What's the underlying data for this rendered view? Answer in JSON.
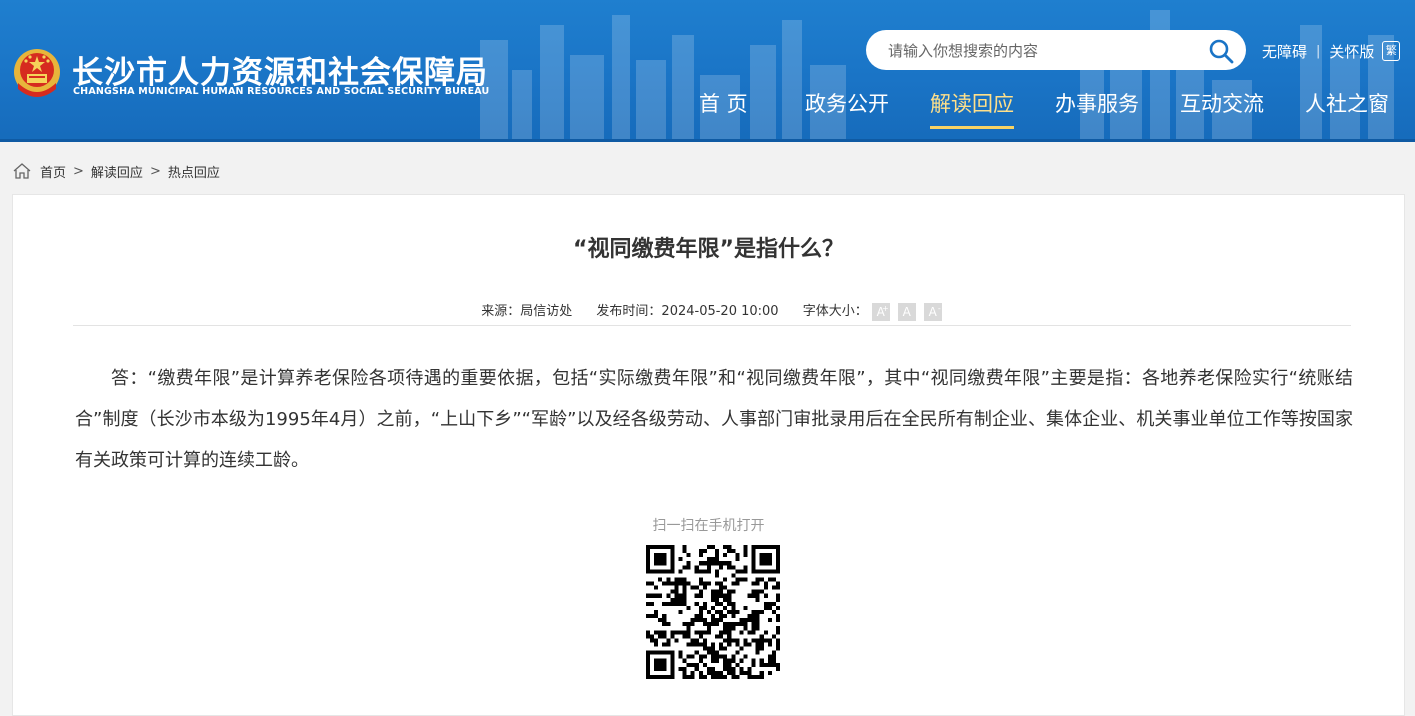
{
  "header": {
    "title": "长沙市人力资源和社会保障局",
    "subtitle": "CHANGSHA MUNICIPAL HUMAN RESOURCES AND SOCIAL SECURITY BUREAU",
    "search_placeholder": "请输入你想搜索的内容",
    "accessibility_link": "无障碍",
    "care_link": "关怀版",
    "traditional_label": "繁",
    "brand_color": "#1a74c6",
    "active_nav_color": "#ffe08a"
  },
  "nav": {
    "items": [
      {
        "label": "首 页"
      },
      {
        "label": "政务公开"
      },
      {
        "label": "解读回应"
      },
      {
        "label": "办事服务"
      },
      {
        "label": "互动交流"
      },
      {
        "label": "人社之窗"
      }
    ],
    "active_index": 2
  },
  "breadcrumb": {
    "items": [
      "首页",
      "解读回应",
      "热点回应"
    ],
    "separator": ">"
  },
  "article": {
    "title": "“视同缴费年限”是指什么？",
    "source": "来源：局信访处",
    "publish_time": "发布时间：2024-05-20 10:00",
    "font_size_label": "字体大小：",
    "font_buttons": {
      "large": "A",
      "large_sup": "+",
      "medium": "A",
      "small": "A",
      "small_sup": "-"
    },
    "body": "答：“缴费年限”是计算养老保险各项待遇的重要依据，包括“实际缴费年限”和“视同缴费年限”，其中“视同缴费年限”主要是指：各地养老保险实行“统账结合”制度（长沙市本级为1995年4月）之前，“上山下乡”“军龄”以及经各级劳动、人事部门审批录用后在全民所有制企业、集体企业、机关事业单位工作等按国家有关政策可计算的连续工龄。",
    "qr_label": "扫一扫在手机打开"
  }
}
